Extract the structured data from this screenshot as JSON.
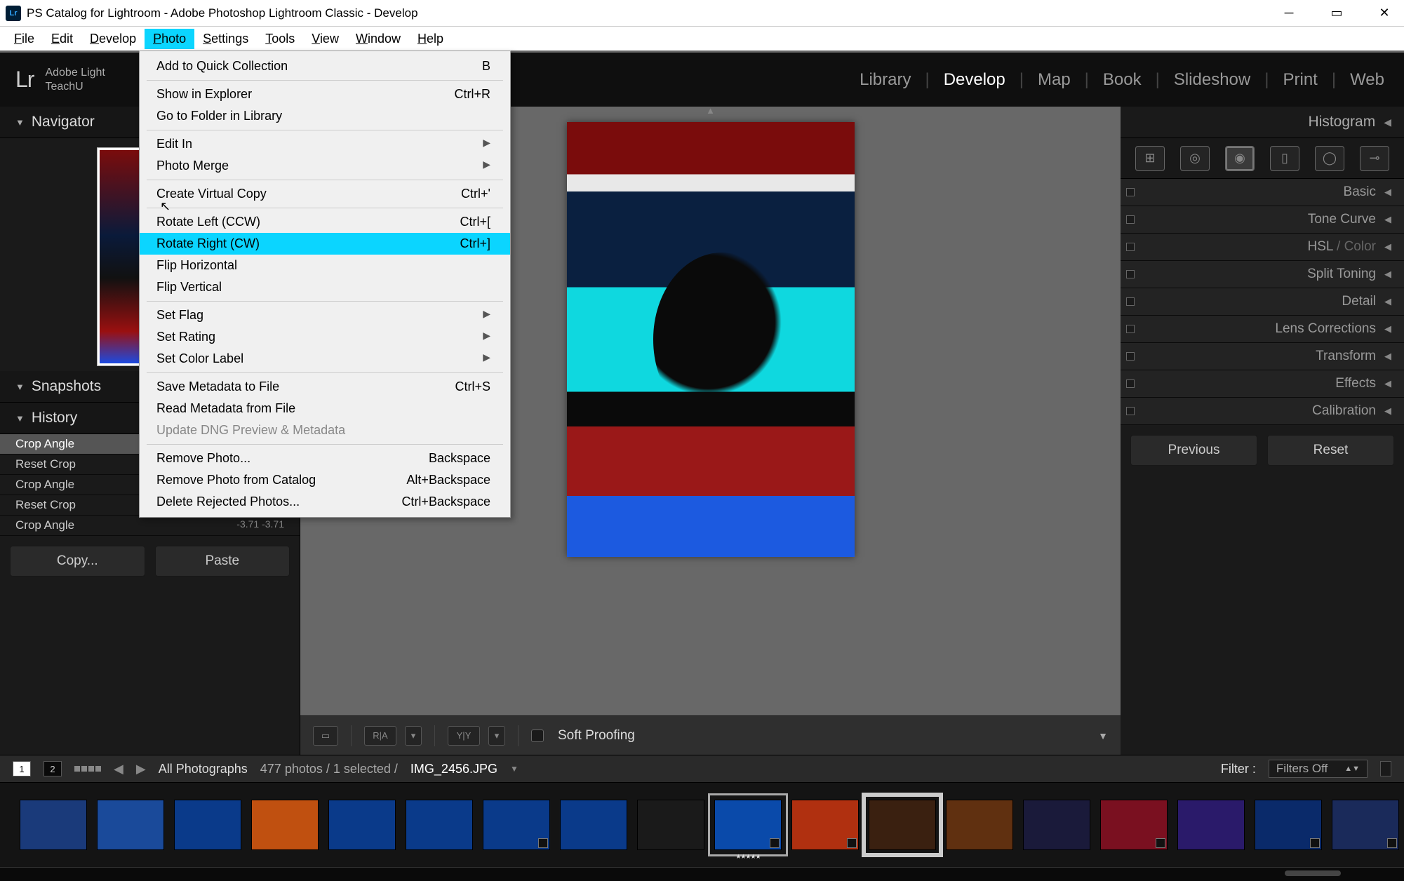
{
  "titlebar": {
    "app_icon": "Lr",
    "title": "PS Catalog for Lightroom - Adobe Photoshop Lightroom Classic - Develop"
  },
  "menubar": {
    "items": [
      "File",
      "Edit",
      "Develop",
      "Photo",
      "Settings",
      "Tools",
      "View",
      "Window",
      "Help"
    ],
    "active_index": 3
  },
  "photo_menu": {
    "items": [
      {
        "label": "Add to Quick Collection",
        "shortcut": "B"
      },
      {
        "sep": true
      },
      {
        "label": "Show in Explorer",
        "shortcut": "Ctrl+R"
      },
      {
        "label": "Go to Folder in Library",
        "shortcut": ""
      },
      {
        "sep": true
      },
      {
        "label": "Edit In",
        "submenu": true
      },
      {
        "label": "Photo Merge",
        "submenu": true
      },
      {
        "sep": true
      },
      {
        "label": "Create Virtual Copy",
        "shortcut": "Ctrl+'"
      },
      {
        "sep": true
      },
      {
        "label": "Rotate Left (CCW)",
        "shortcut": "Ctrl+["
      },
      {
        "label": "Rotate Right (CW)",
        "shortcut": "Ctrl+]",
        "highlight": true
      },
      {
        "label": "Flip Horizontal",
        "shortcut": ""
      },
      {
        "label": "Flip Vertical",
        "shortcut": ""
      },
      {
        "sep": true
      },
      {
        "label": "Set Flag",
        "submenu": true
      },
      {
        "label": "Set Rating",
        "submenu": true
      },
      {
        "label": "Set Color Label",
        "submenu": true
      },
      {
        "sep": true
      },
      {
        "label": "Save Metadata to File",
        "shortcut": "Ctrl+S"
      },
      {
        "label": "Read Metadata from File",
        "shortcut": ""
      },
      {
        "label": "Update DNG Preview & Metadata",
        "disabled": true
      },
      {
        "sep": true
      },
      {
        "label": "Remove Photo...",
        "shortcut": "Backspace"
      },
      {
        "label": "Remove Photo from Catalog",
        "shortcut": "Alt+Backspace"
      },
      {
        "label": "Delete Rejected Photos...",
        "shortcut": "Ctrl+Backspace"
      }
    ]
  },
  "id_plate": {
    "line1": "Adobe Light",
    "line2": "TeachU"
  },
  "modules": [
    "Library",
    "Develop",
    "Map",
    "Book",
    "Slideshow",
    "Print",
    "Web"
  ],
  "modules_active_index": 1,
  "left_panel": {
    "navigator_title": "Navigator",
    "snapshots_title": "Snapshots",
    "history_title": "History",
    "history": [
      {
        "label": "Crop Angle",
        "selected": true
      },
      {
        "label": "Reset Crop"
      },
      {
        "label": "Crop Angle"
      },
      {
        "label": "Reset Crop"
      },
      {
        "label": "Crop Angle",
        "vals": "-3.71   -3.71"
      }
    ],
    "copy_btn": "Copy...",
    "paste_btn": "Paste"
  },
  "right_panel": {
    "histogram_title": "Histogram",
    "sections": [
      "Basic",
      "Tone Curve",
      "HSL / Color",
      "Split Toning",
      "Detail",
      "Lens Corrections",
      "Transform",
      "Effects",
      "Calibration"
    ],
    "hsl_parts": {
      "a": "HSL",
      "b": " / ",
      "c": "Color"
    },
    "previous_btn": "Previous",
    "reset_btn": "Reset"
  },
  "toolbar": {
    "soft_proofing": "Soft Proofing"
  },
  "filmstrip_bar": {
    "chip1": "1",
    "chip2": "2",
    "source": "All Photographs",
    "count": "477 photos / 1 selected /",
    "filename": "IMG_2456.JPG",
    "filter_label": "Filter :",
    "filter_value": "Filters Off"
  },
  "filmstrip": {
    "thumb_count": 18,
    "selected_index": 9,
    "secondary_index": 11
  }
}
